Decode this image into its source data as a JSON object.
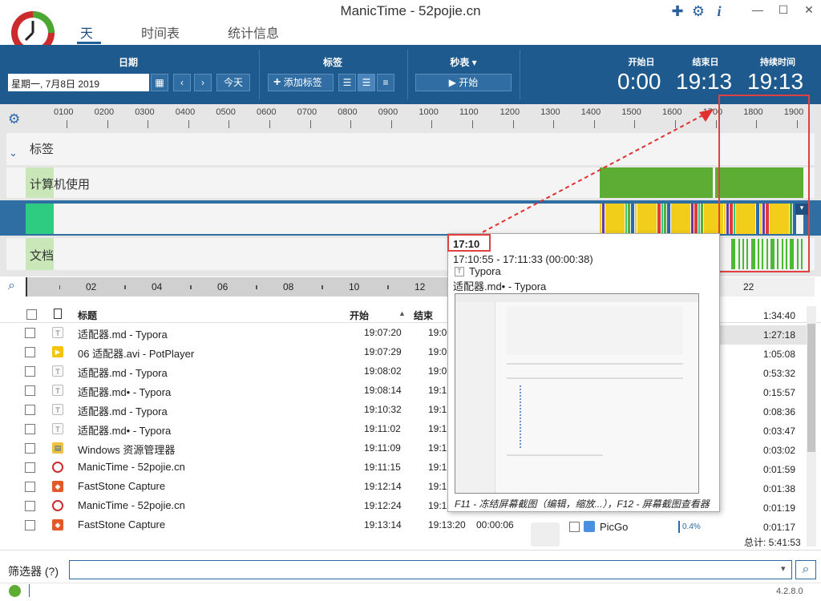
{
  "app": {
    "title": "ManicTime - 52pojie.cn"
  },
  "nav": {
    "tabs": [
      "天",
      "时间表",
      "统计信息"
    ]
  },
  "window": {
    "min": "—",
    "max": "☐",
    "close": "✕"
  },
  "toolbar": {
    "date_group": "日期",
    "date_value": "星期一, 7月8日 2019",
    "today": "今天",
    "tag_group": "标签",
    "add_tag": "添加标签",
    "stopwatch_group": "秒表 ▾",
    "start": "开始",
    "start_label": "开始日",
    "end_label": "结束日",
    "duration_label": "持续时间",
    "start_value": "0:00",
    "end_value": "19:13",
    "duration_value": "19:13"
  },
  "timeline": {
    "hours": [
      "0100",
      "0200",
      "0300",
      "0400",
      "0500",
      "0600",
      "0700",
      "0800",
      "0900",
      "1000",
      "1100",
      "1200",
      "1300",
      "1400",
      "1500",
      "1600",
      "1700",
      "1800",
      "1900"
    ],
    "rows": {
      "tags": "标签",
      "computer": "计算机使用",
      "documents": "文档"
    },
    "zoom_ticks": [
      "02",
      "04",
      "06",
      "08",
      "10",
      "12",
      "22"
    ]
  },
  "list": {
    "headers": {
      "title": "标题",
      "start": "开始",
      "end": "结束"
    },
    "rows": [
      {
        "icon": "typora",
        "title": "适配器.md - Typora",
        "start": "19:07:20",
        "end": "19:0"
      },
      {
        "icon": "potplayer",
        "title": "06 适配器.avi - PotPlayer",
        "start": "19:07:29",
        "end": "19:0"
      },
      {
        "icon": "typora",
        "title": "适配器.md - Typora",
        "start": "19:08:02",
        "end": "19:0"
      },
      {
        "icon": "typora",
        "title": "适配器.md• - Typora",
        "start": "19:08:14",
        "end": "19:1"
      },
      {
        "icon": "typora",
        "title": "适配器.md - Typora",
        "start": "19:10:32",
        "end": "19:1"
      },
      {
        "icon": "typora",
        "title": "适配器.md• - Typora",
        "start": "19:11:02",
        "end": "19:1"
      },
      {
        "icon": "explorer",
        "title": "Windows 资源管理器",
        "start": "19:11:09",
        "end": "19:1"
      },
      {
        "icon": "manictime",
        "title": "ManicTime - 52pojie.cn",
        "start": "19:11:15",
        "end": "19:1"
      },
      {
        "icon": "faststone",
        "title": "FastStone Capture",
        "start": "19:12:14",
        "end": "19:1"
      },
      {
        "icon": "manictime",
        "title": "ManicTime - 52pojie.cn",
        "start": "19:12:24",
        "end": "19:1"
      },
      {
        "icon": "faststone",
        "title": "FastStone Capture",
        "start": "19:13:14",
        "end": "19:13:20",
        "extra": "00:00:06"
      }
    ],
    "right_durations": [
      "1:34:40",
      "1:27:18",
      "1:05:08",
      "0:53:32",
      "0:15:57",
      "0:08:36",
      "0:03:47",
      "0:03:02",
      "0:01:59",
      "0:01:38",
      "0:01:19",
      "0:01:17"
    ],
    "picgo": {
      "name": "PicGo",
      "pct": "0.4%"
    },
    "total": "总计: 5:41:53"
  },
  "popup": {
    "time": "17:10",
    "range": "17:10:55 - 17:11:33 (00:00:38)",
    "app": "Typora",
    "doc": "适配器.md• - Typora",
    "hint": "F11 - 冻结屏幕截图（编辑，缩放...），F12 - 屏幕截图查看器"
  },
  "filter": {
    "label": "筛选器 (?)"
  },
  "status": {
    "version": "4.2.8.0"
  },
  "colors": {
    "accent": "#1f5a8f",
    "green": "#5dad35",
    "teal": "#2ecc80",
    "yellow": "#f2cd1a",
    "purple": "#6a3a9a",
    "red": "#e03a3a"
  }
}
